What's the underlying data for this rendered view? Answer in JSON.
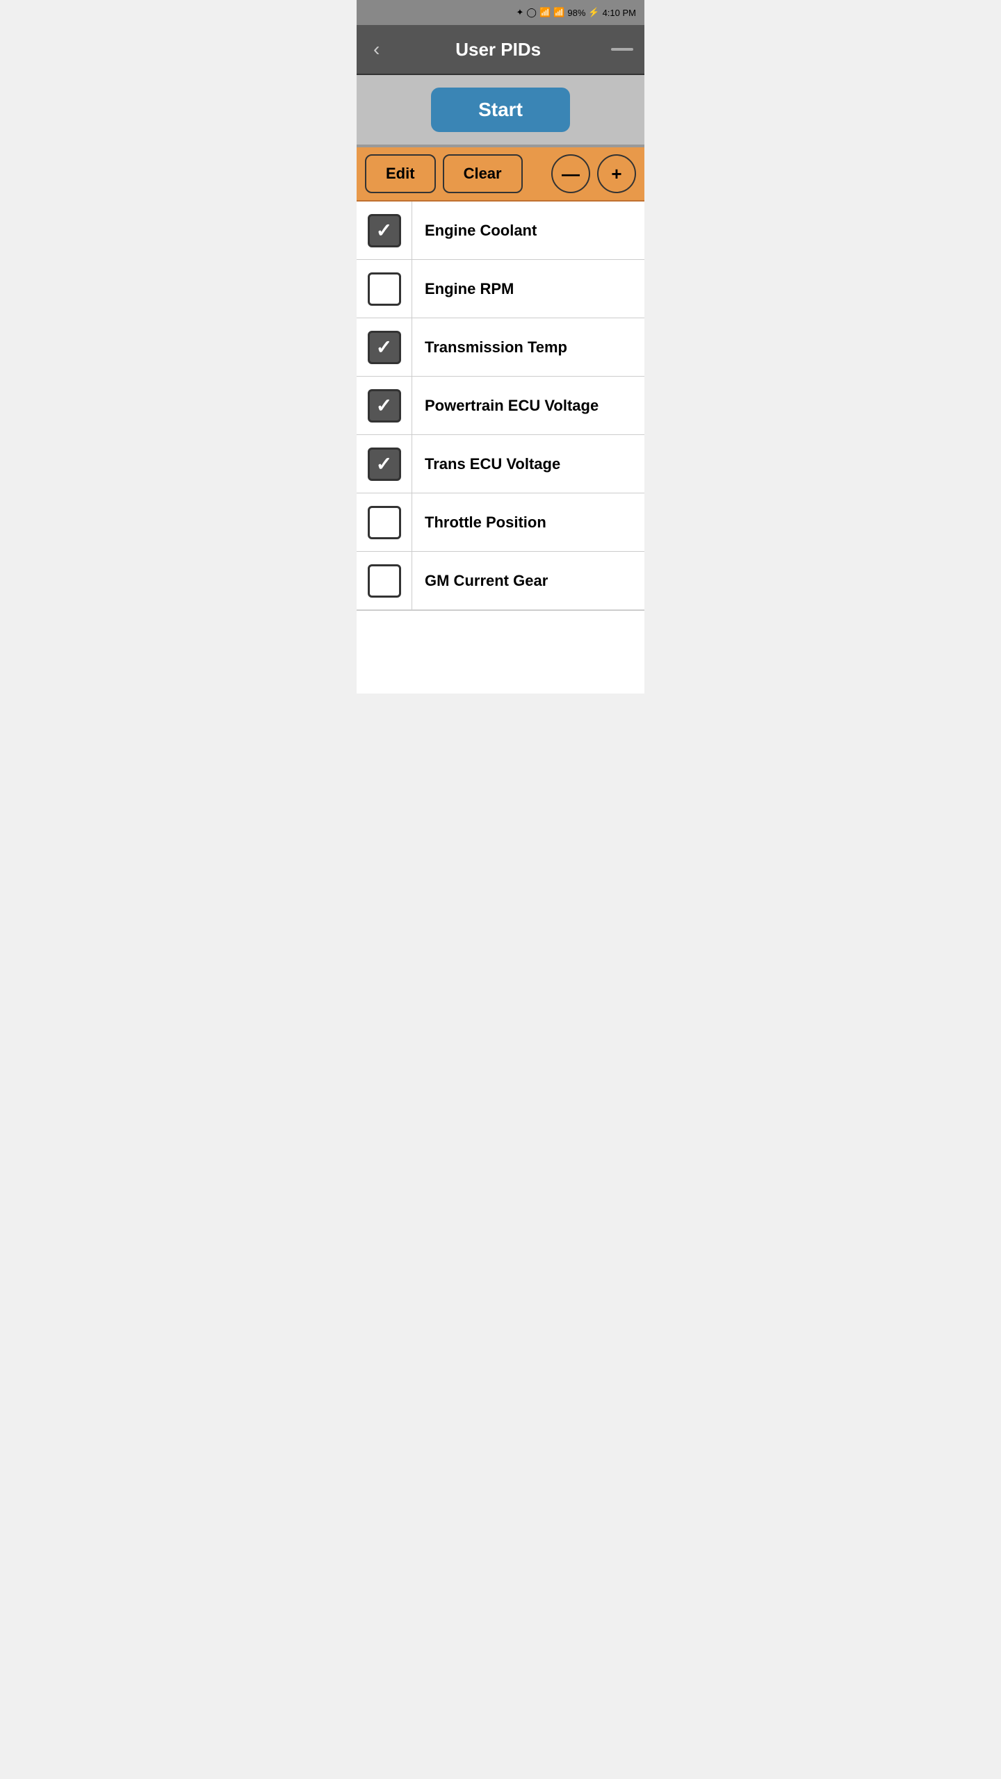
{
  "statusBar": {
    "battery": "98%",
    "time": "4:10 PM",
    "icons": "🔵 ⏰ 📶 📶 📶"
  },
  "header": {
    "backLabel": "‹",
    "title": "User PIDs",
    "menuIcon": "—"
  },
  "startButton": {
    "label": "Start"
  },
  "toolbar": {
    "editLabel": "Edit",
    "clearLabel": "Clear",
    "decrementLabel": "—",
    "incrementLabel": "+"
  },
  "pidItems": [
    {
      "id": 1,
      "label": "Engine Coolant",
      "checked": true
    },
    {
      "id": 2,
      "label": "Engine RPM",
      "checked": false
    },
    {
      "id": 3,
      "label": "Transmission Temp",
      "checked": true
    },
    {
      "id": 4,
      "label": "Powertrain ECU Voltage",
      "checked": true
    },
    {
      "id": 5,
      "label": "Trans ECU Voltage",
      "checked": true
    },
    {
      "id": 6,
      "label": "Throttle Position",
      "checked": false
    },
    {
      "id": 7,
      "label": "GM Current Gear",
      "checked": false
    }
  ]
}
